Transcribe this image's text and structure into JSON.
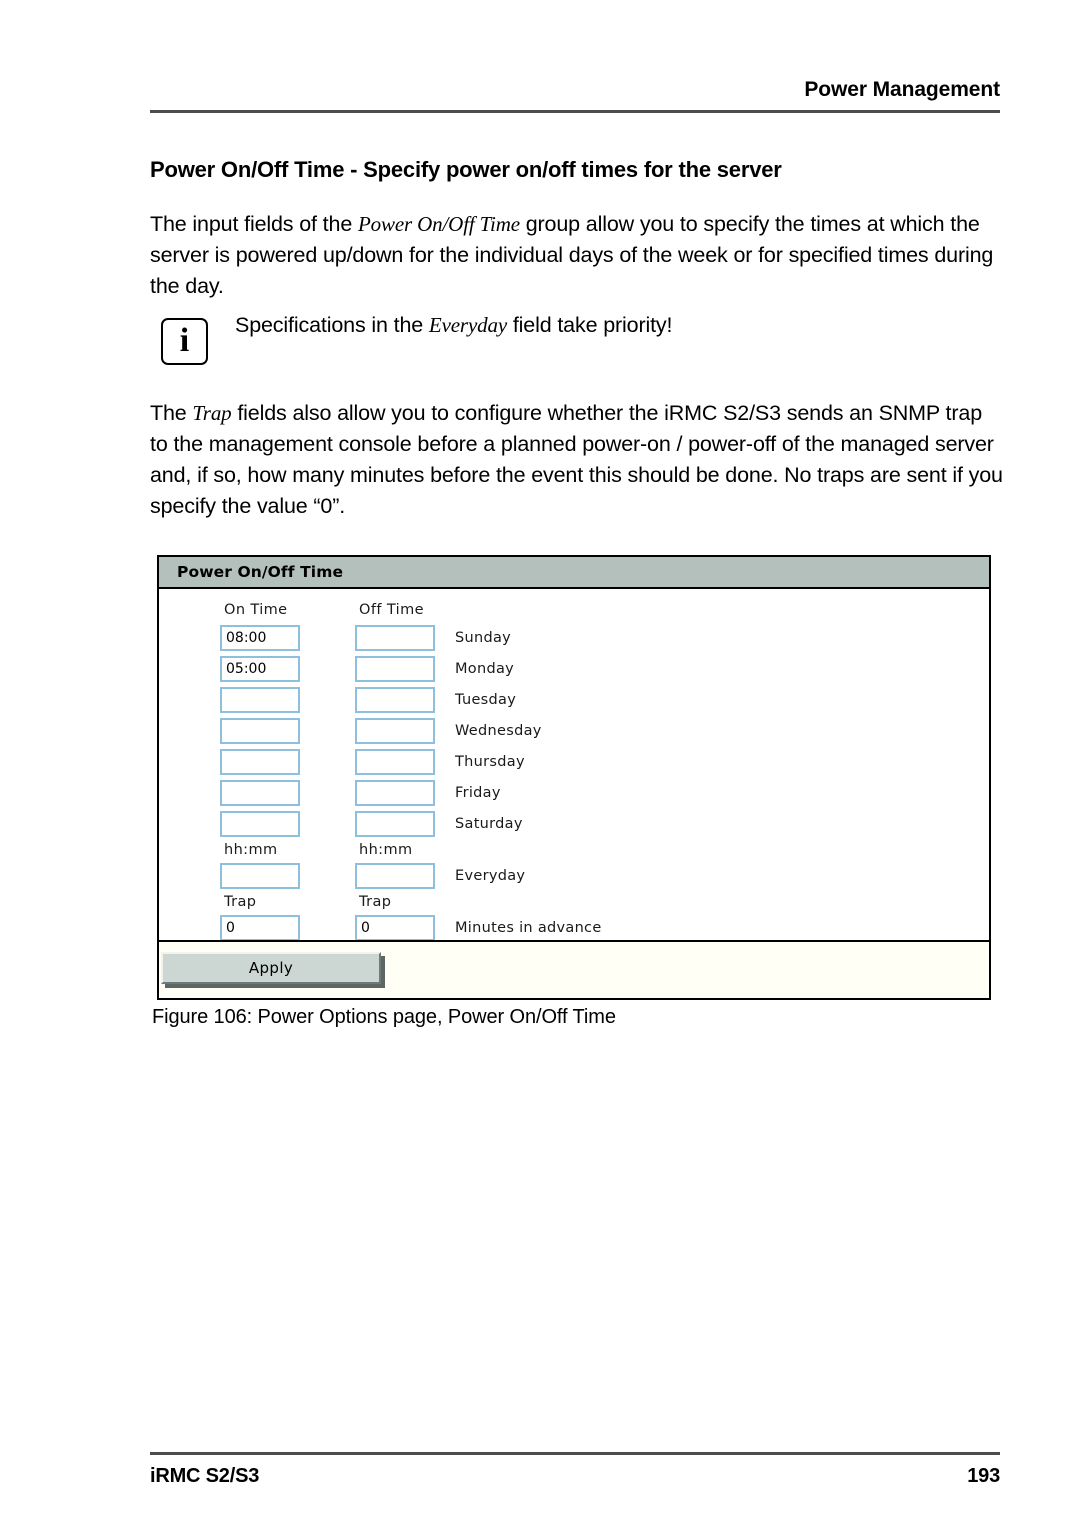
{
  "header": {
    "running_title": "Power Management"
  },
  "section": {
    "heading": "Power On/Off Time - Specify power on/off times for the server"
  },
  "paragraphs": {
    "intro_part1": "The input fields of the ",
    "intro_emphasis": "Power On/Off Time",
    "intro_part2": " group allow you to specify the times at which the server is powered up/down for the individual days of the week or for specified times during the day.",
    "trap_part1": "The ",
    "trap_emphasis": "Trap",
    "trap_part2": " fields also allow you to configure whether the iRMC S2/S3 sends an SNMP trap to the management console before a planned power-on / power-off of the managed server and, if so, how many minutes before the event this should be done. No traps are sent if you specify the value “0”."
  },
  "note": {
    "icon": "info-icon",
    "glyph": "i",
    "text_part1": "Specifications in the ",
    "text_emphasis": "Everyday",
    "text_part2": " field take priority!"
  },
  "screenshot": {
    "panel_title": "Power On/Off Time",
    "column_headers": {
      "on": "On Time",
      "off": "Off Time"
    },
    "rows": [
      {
        "label": "Sunday",
        "on_value": "08:00",
        "off_value": ""
      },
      {
        "label": "Monday",
        "on_value": "05:00",
        "off_value": ""
      },
      {
        "label": "Tuesday",
        "on_value": "",
        "off_value": ""
      },
      {
        "label": "Wednesday",
        "on_value": "",
        "off_value": ""
      },
      {
        "label": "Thursday",
        "on_value": "",
        "off_value": ""
      },
      {
        "label": "Friday",
        "on_value": "",
        "off_value": ""
      },
      {
        "label": "Saturday",
        "on_value": "",
        "off_value": ""
      }
    ],
    "format_hint": {
      "on": "hh:mm",
      "off": "hh:mm"
    },
    "everyday_row": {
      "label": "Everyday",
      "on_value": "",
      "off_value": ""
    },
    "trap_hint": {
      "on": "Trap",
      "off": "Trap"
    },
    "minutes_row": {
      "label": "Minutes in advance",
      "on_value": "0",
      "off_value": "0"
    },
    "apply_label": "Apply",
    "colors": {
      "title_bar": "#b3c0bc",
      "field_border": "#8ec0de",
      "button_face": "#ccd6d2"
    }
  },
  "figure": {
    "caption": "Figure 106: Power Options page, Power On/Off Time"
  },
  "footer": {
    "product": "iRMC S2/S3",
    "page_number": "193"
  }
}
